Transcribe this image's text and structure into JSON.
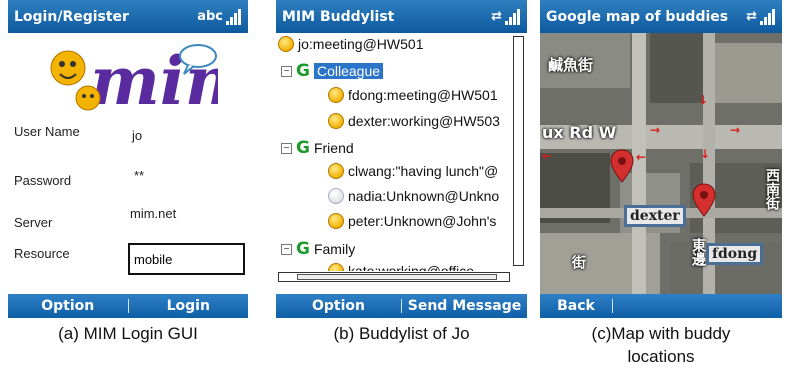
{
  "login": {
    "title": "Login/Register",
    "input_mode": "abc",
    "fields": [
      {
        "label": "User Name",
        "value": "jo"
      },
      {
        "label": "Password",
        "value": "**"
      },
      {
        "label": "Server",
        "value": "mim.net"
      },
      {
        "label": "Resource",
        "value": "mobile"
      }
    ],
    "softkey_left": "Option",
    "softkey_right": "Login",
    "caption": "(a) MIM Login GUI"
  },
  "buddylist": {
    "title": "MIM Buddylist",
    "self_status": "jo:meeting@HW501",
    "groups": [
      {
        "name": "Colleague",
        "members": [
          "fdong:meeting@HW501",
          "dexter:working@HW503"
        ]
      },
      {
        "name": "Friend",
        "members": [
          "clwang:\"having lunch\"@",
          "nadia:Unknown@Unkno",
          "peter:Unknown@John's"
        ]
      },
      {
        "name": "Family",
        "members": [
          "kate:working@office"
        ]
      }
    ],
    "softkey_left": "Option",
    "softkey_right": "Send Message",
    "caption": "(b) Buddylist of Jo"
  },
  "map": {
    "title": "Google map of buddies",
    "street_1": "鹹魚街",
    "street_2": "ux Rd W",
    "street_3": "西南街",
    "street_4": "東邊",
    "street_5": "街",
    "buddy_1": "dexter",
    "buddy_2": "fdong",
    "softkey_left": "Back",
    "caption_line1": "(c)Map with buddy",
    "caption_line2": "locations"
  },
  "colors": {
    "titlebar": "#1b6cb0",
    "selection": "#2a74c9",
    "group_icon": "#1d9a2b",
    "pin": "#d32f2f"
  }
}
